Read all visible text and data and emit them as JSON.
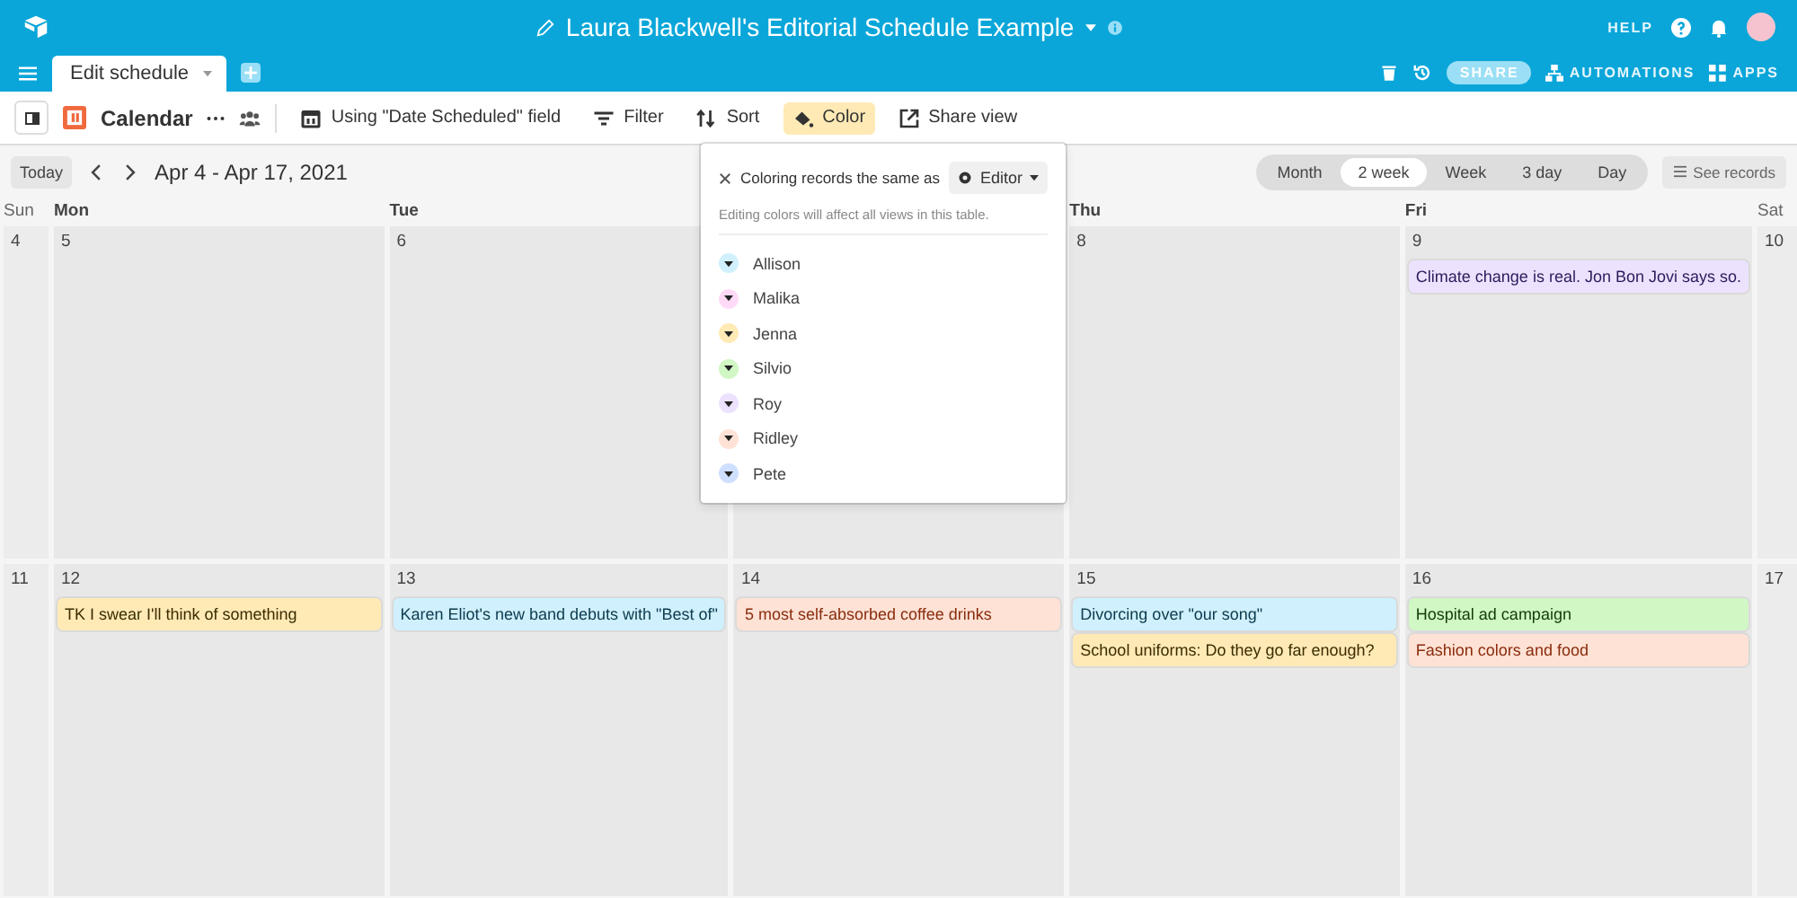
{
  "header": {
    "title": "Laura Blackwell's Editorial Schedule Example",
    "help": "HELP"
  },
  "tabbar": {
    "tabs": [
      {
        "label": "Edit schedule",
        "selected": true
      }
    ],
    "share": "SHARE",
    "automations": "AUTOMATIONS",
    "apps": "APPS"
  },
  "toolbar": {
    "view_name": "Calendar",
    "items": [
      {
        "label": "Using \"Date Scheduled\" field",
        "selected": false
      },
      {
        "label": "Filter",
        "selected": false
      },
      {
        "label": "Sort",
        "selected": false
      },
      {
        "label": "Color",
        "selected": true
      },
      {
        "label": "Share view",
        "selected": false
      }
    ]
  },
  "calendar": {
    "today": "Today",
    "range": "Apr 4 - Apr 17, 2021",
    "modes": [
      {
        "label": "Month",
        "selected": false
      },
      {
        "label": "2 week",
        "selected": true
      },
      {
        "label": "Week",
        "selected": false
      },
      {
        "label": "3 day",
        "selected": false
      },
      {
        "label": "Day",
        "selected": false
      }
    ],
    "see_records": "See records",
    "weeks": [
      [
        {
          "weekday": "Sun",
          "day": "4"
        },
        {
          "weekday": "Mon",
          "day": "5"
        },
        {
          "weekday": "Tue",
          "day": "6"
        },
        {
          "kind": "covered"
        },
        {
          "weekday": "Thu",
          "day": "8"
        },
        {
          "weekday": "Fri",
          "day": "9",
          "events": [
            {
              "title": "Climate change is real. Jon Bon Jovi says so.",
              "color": "#ede2fe"
            }
          ]
        },
        {
          "weekday": "Sat",
          "day": "10"
        }
      ],
      [
        {
          "day": "11"
        },
        {
          "day": "12",
          "events": [
            {
              "title": "TK I swear I'll think of something",
              "color": "#ffeab6"
            }
          ]
        },
        {
          "day": "13",
          "events": [
            {
              "title": "Karen Eliot's new band debuts with \"Best of\"",
              "color": "#d0f0fd"
            }
          ]
        },
        {
          "day": "14",
          "events": [
            {
              "title": "5 most self-absorbed coffee drinks",
              "color": "#fee2d5"
            }
          ]
        },
        {
          "day": "15",
          "events": [
            {
              "title": "Divorcing over \"our song\"",
              "color": "#d0f0fd"
            },
            {
              "title": "School uniforms: Do they go far enough?",
              "color": "#ffeab6"
            }
          ]
        },
        {
          "day": "16",
          "events": [
            {
              "title": "Hospital ad campaign",
              "color": "#d1f7c4"
            },
            {
              "title": "Fashion colors and food",
              "color": "#fee2d5"
            }
          ]
        },
        {
          "day": "17"
        }
      ]
    ]
  },
  "color_popup": {
    "prefix": "Coloring records the same as",
    "field": "Editor",
    "note": "Editing colors will affect all views in this table.",
    "options": [
      {
        "name": "Allison",
        "color": "#d0f0fd"
      },
      {
        "name": "Malika",
        "color": "#ffdaf6"
      },
      {
        "name": "Jenna",
        "color": "#ffeab6"
      },
      {
        "name": "Silvio",
        "color": "#d1f7c4"
      },
      {
        "name": "Roy",
        "color": "#ede2fe"
      },
      {
        "name": "Ridley",
        "color": "#fee2d5"
      },
      {
        "name": "Pete",
        "color": "#cfdfff"
      }
    ]
  }
}
